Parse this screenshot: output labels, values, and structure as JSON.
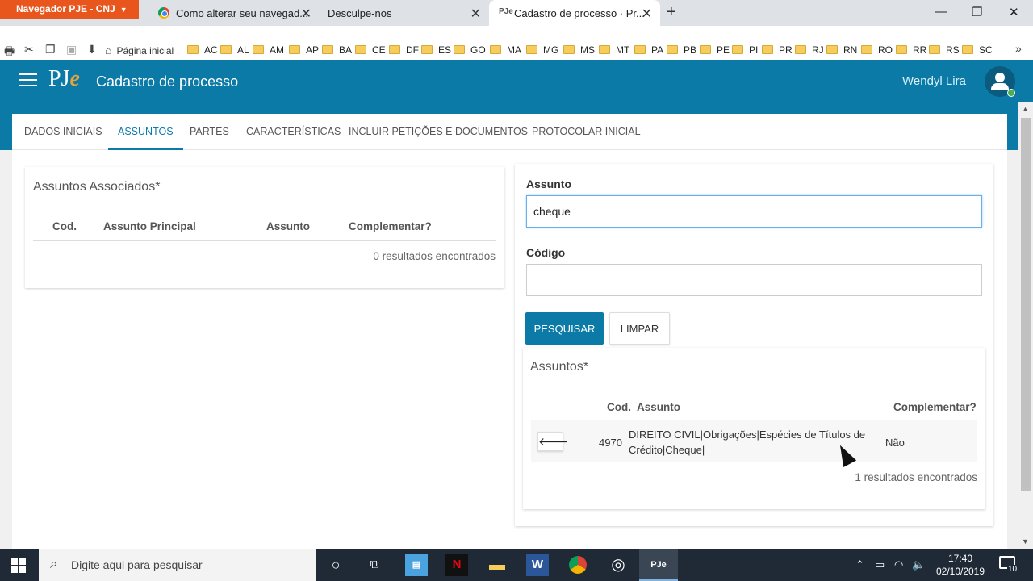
{
  "browser": {
    "profile_button": "Navegador PJE - CNJ",
    "tabs": [
      {
        "label": "Como alterar seu navegad...",
        "close": "✕"
      },
      {
        "label": "Desculpe-nos",
        "close": "✕"
      },
      {
        "label": "Cadastro de processo · Pr...",
        "close": "✕"
      }
    ],
    "new_tab": "+",
    "window_controls": {
      "minimize": "—",
      "restore": "❐",
      "close": "✕"
    }
  },
  "bookmarks": {
    "home_label": "Página inicial",
    "items": [
      "AC",
      "AL",
      "AM",
      "AP",
      "BA",
      "CE",
      "DF",
      "ES",
      "GO",
      "MA",
      "MG",
      "MS",
      "MT",
      "PA",
      "PB",
      "PE",
      "PI",
      "PR",
      "RJ",
      "RN",
      "RO",
      "RR",
      "RS",
      "SC"
    ]
  },
  "header": {
    "logo_p": "PJ",
    "logo_e": "e",
    "title": "Cadastro de processo",
    "user_name": "Wendyl Lira"
  },
  "nav_tabs": [
    "DADOS INICIAIS",
    "ASSUNTOS",
    "PARTES",
    "CARACTERÍSTICAS",
    "INCLUIR PETIÇÕES E DOCUMENTOS",
    "PROTOCOLAR INICIAL"
  ],
  "associated": {
    "title": "Assuntos Associados*",
    "columns": [
      "Cod.",
      "Assunto Principal",
      "Assunto",
      "Complementar?"
    ],
    "result_count": "0 resultados encontrados"
  },
  "search": {
    "subject_label": "Assunto",
    "subject_value": "cheque",
    "code_label": "Código",
    "code_value": "",
    "search_button": "PESQUISAR",
    "clear_button": "LIMPAR"
  },
  "results": {
    "title": "Assuntos*",
    "columns": [
      "Cod.",
      "Assunto",
      "Complementar?"
    ],
    "rows": [
      {
        "action": "🡐",
        "code": "4970",
        "subject_line1": "DIREITO CIVIL|Obrigações|Espécies de Títulos de",
        "subject_line2": "Crédito|Cheque|",
        "complement": "Não"
      }
    ],
    "result_count": "1 resultados encontrados"
  },
  "taskbar": {
    "search_placeholder": "Digite aqui para pesquisar",
    "time": "17:40",
    "date": "02/10/2019",
    "notification_count": "10"
  },
  "colors": {
    "brand": "#0b7aa6",
    "profile": "#e8561e",
    "taskbar": "#1f2a36"
  }
}
